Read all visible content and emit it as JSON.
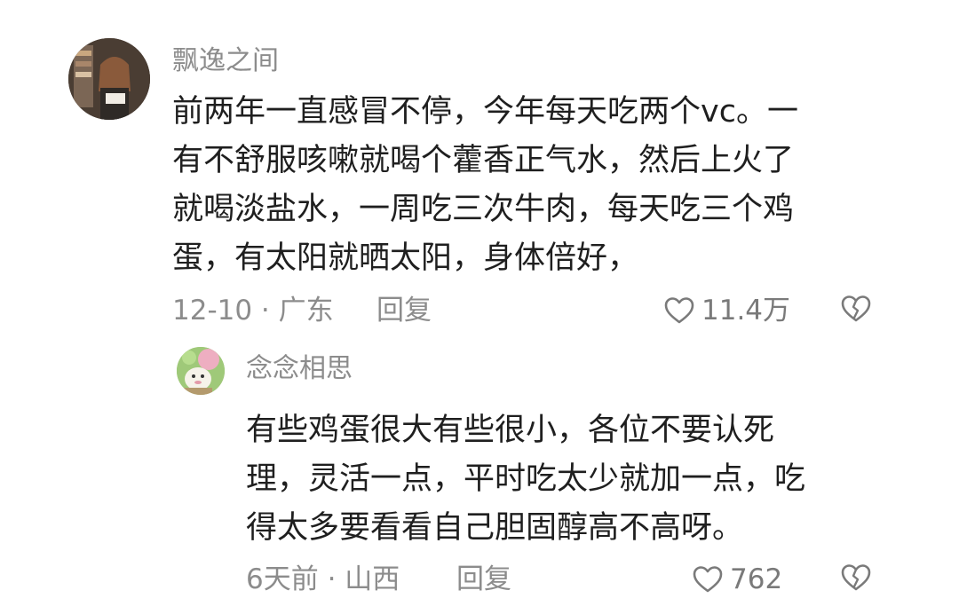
{
  "comments": [
    {
      "username": "飘逸之间",
      "lines": [
        "前两年一直感冒不停，今年每天吃两个vc。一",
        "有不舒服咳嗽就喝个藿香正气水，然后上火了",
        "就喝淡盐水，一周吃三次牛肉，每天吃三个鸡",
        "蛋，有太阳就晒太阳，身体倍好，"
      ],
      "meta": "12-10 · 广东",
      "reply_label": "回复",
      "like_count": "11.4万"
    },
    {
      "username": "念念相思",
      "lines": [
        "有些鸡蛋很大有些很小，各位不要认死",
        "理，灵活一点，平时吃太少就加一点，吃",
        "得太多要看看自己胆固醇高不高呀。"
      ],
      "meta": "6天前 · 山西",
      "reply_label": "回复",
      "like_count": "762"
    }
  ],
  "icons": {
    "like": "heart-outline-icon",
    "dislike": "broken-heart-icon"
  },
  "colors": {
    "text": "#1f1f1f",
    "secondary": "#8c8c8c"
  }
}
